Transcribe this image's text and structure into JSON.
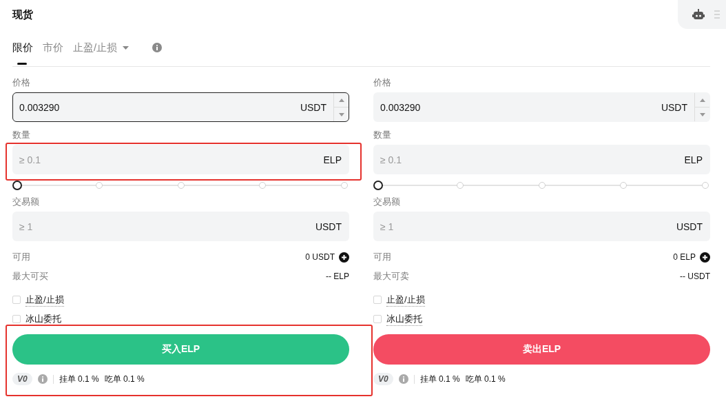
{
  "header": {
    "title": "现货"
  },
  "order_tabs": [
    {
      "label": "限价",
      "selected": true,
      "dropdown": false
    },
    {
      "label": "市价",
      "selected": false,
      "dropdown": false
    },
    {
      "label": "止盈/止损",
      "selected": false,
      "dropdown": true
    }
  ],
  "forms": [
    {
      "kind": "buy",
      "price": {
        "label": "价格",
        "value": "0.003290",
        "unit": "USDT",
        "focused": true
      },
      "quantity": {
        "label": "数量",
        "placeholder": "≥ 0.1",
        "unit": "ELP",
        "highlighted": true
      },
      "slider": {
        "level": 0
      },
      "amount": {
        "label": "交易额",
        "placeholder": "≥ 1",
        "unit": "USDT"
      },
      "available": {
        "label": "可用",
        "value": "0 USDT"
      },
      "max": {
        "label": "最大可买",
        "value": "-- ELP"
      },
      "options": [
        {
          "label": "止盈/止损",
          "checked": false
        },
        {
          "label": "冰山委托",
          "checked": false
        }
      ],
      "action": {
        "label": "买入ELP",
        "highlighted": true
      },
      "fees": {
        "tier": "V0",
        "maker": "挂单",
        "maker_value": "0.1 %",
        "taker": "吃单",
        "taker_value": "0.1 %"
      }
    },
    {
      "kind": "sell",
      "price": {
        "label": "价格",
        "value": "0.003290",
        "unit": "USDT",
        "focused": false
      },
      "quantity": {
        "label": "数量",
        "placeholder": "≥ 0.1",
        "unit": "ELP",
        "highlighted": false
      },
      "slider": {
        "level": 0
      },
      "amount": {
        "label": "交易额",
        "placeholder": "≥ 1",
        "unit": "USDT"
      },
      "available": {
        "label": "可用",
        "value": "0 ELP"
      },
      "max": {
        "label": "最大可卖",
        "value": "-- USDT"
      },
      "options": [
        {
          "label": "止盈/止损",
          "checked": false
        },
        {
          "label": "冰山委托",
          "checked": false
        }
      ],
      "action": {
        "label": "卖出ELP",
        "highlighted": false
      },
      "fees": {
        "tier": "V0",
        "maker": "挂单",
        "maker_value": "0.1 %",
        "taker": "吃单",
        "taker_value": "0.1 %"
      }
    }
  ]
}
